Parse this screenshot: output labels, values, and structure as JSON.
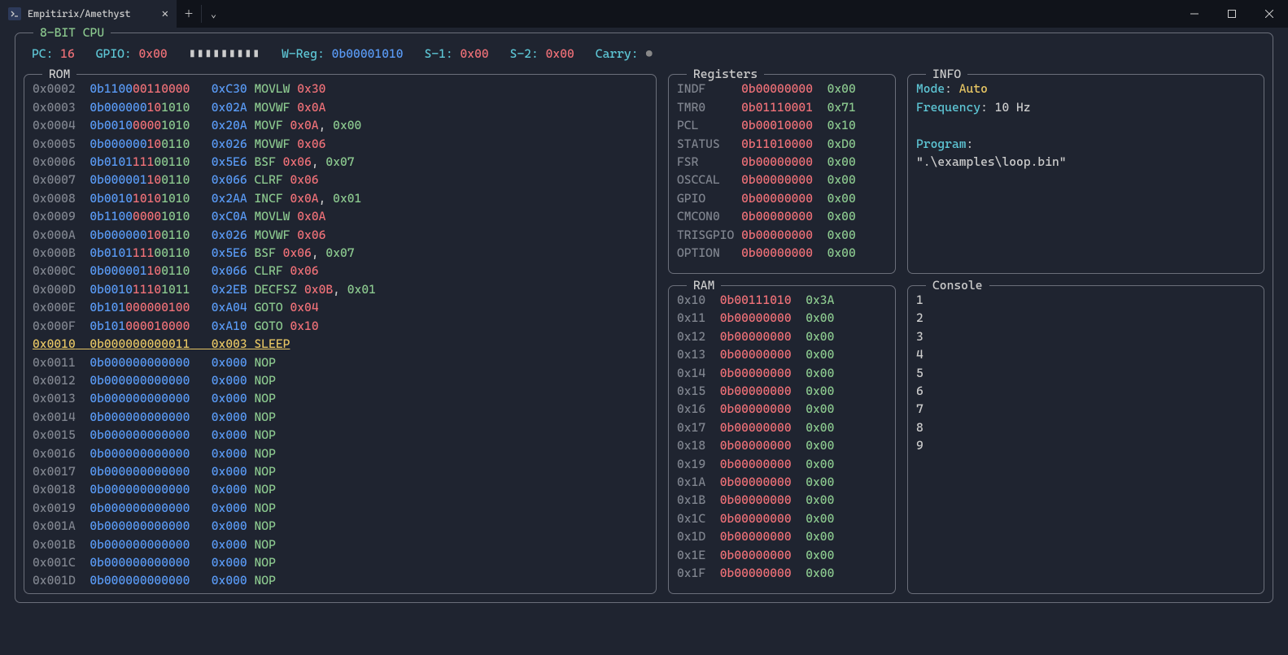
{
  "window": {
    "tab_title": "Empitirix/Amethyst"
  },
  "cpu_title": "8-BIT CPU",
  "status": {
    "pc_label": "PC:",
    "pc_value": "16",
    "gpio_label": "GPIO:",
    "gpio_value": "0x00",
    "gpio_bars": "▮▮▮▮▮▮▮▮▮",
    "wreg_label": "W-Reg:",
    "wreg_value": "0b00001010",
    "s1_label": "S-1:",
    "s1_value": "0x00",
    "s2_label": "S-2:",
    "s2_value": "0x00",
    "carry_label": "Carry:",
    "carry_dot": "●"
  },
  "rom_title": "ROM",
  "registers_title": "Registers",
  "info_title": "INFO",
  "ram_title": "RAM",
  "console_title": "Console",
  "rom": [
    {
      "addr": "0x0002",
      "bin_segs": [
        [
          "b",
          "0b1100"
        ],
        [
          "r",
          "00110000"
        ]
      ],
      "hex": "0xC30",
      "mn": "MOVLW",
      "args": [
        [
          "r",
          "0x30"
        ]
      ]
    },
    {
      "addr": "0x0003",
      "bin_segs": [
        [
          "b",
          "0b000000"
        ],
        [
          "r",
          "10"
        ],
        [
          "g",
          "1010"
        ]
      ],
      "hex": "0x02A",
      "mn": "MOVWF",
      "args": [
        [
          "r",
          "0x0A"
        ]
      ]
    },
    {
      "addr": "0x0004",
      "bin_segs": [
        [
          "b",
          "0b0010"
        ],
        [
          "r",
          "0000"
        ],
        [
          "g",
          "1010"
        ]
      ],
      "hex": "0x20A",
      "mn": "MOVF",
      "args": [
        [
          "r",
          "0x0A"
        ],
        [
          "w",
          ", "
        ],
        [
          "g",
          "0x00"
        ]
      ]
    },
    {
      "addr": "0x0005",
      "bin_segs": [
        [
          "b",
          "0b000000"
        ],
        [
          "r",
          "10"
        ],
        [
          "g",
          "0110"
        ]
      ],
      "hex": "0x026",
      "mn": "MOVWF",
      "args": [
        [
          "r",
          "0x06"
        ]
      ]
    },
    {
      "addr": "0x0006",
      "bin_segs": [
        [
          "b",
          "0b0101"
        ],
        [
          "r",
          "111"
        ],
        [
          "g",
          "00110"
        ]
      ],
      "hex": "0x5E6",
      "mn": "BSF",
      "args": [
        [
          "r",
          "0x06"
        ],
        [
          "w",
          ", "
        ],
        [
          "g",
          "0x07"
        ]
      ]
    },
    {
      "addr": "0x0007",
      "bin_segs": [
        [
          "b",
          "0b000001"
        ],
        [
          "r",
          "10"
        ],
        [
          "g",
          "0110"
        ]
      ],
      "hex": "0x066",
      "mn": "CLRF",
      "args": [
        [
          "r",
          "0x06"
        ]
      ]
    },
    {
      "addr": "0x0008",
      "bin_segs": [
        [
          "b",
          "0b0010"
        ],
        [
          "r",
          "1010"
        ],
        [
          "g",
          "1010"
        ]
      ],
      "hex": "0x2AA",
      "mn": "INCF",
      "args": [
        [
          "r",
          "0x0A"
        ],
        [
          "w",
          ", "
        ],
        [
          "g",
          "0x01"
        ]
      ]
    },
    {
      "addr": "0x0009",
      "bin_segs": [
        [
          "b",
          "0b1100"
        ],
        [
          "r",
          "0000"
        ],
        [
          "g",
          "1010"
        ]
      ],
      "hex": "0xC0A",
      "mn": "MOVLW",
      "args": [
        [
          "r",
          "0x0A"
        ]
      ]
    },
    {
      "addr": "0x000A",
      "bin_segs": [
        [
          "b",
          "0b000000"
        ],
        [
          "r",
          "10"
        ],
        [
          "g",
          "0110"
        ]
      ],
      "hex": "0x026",
      "mn": "MOVWF",
      "args": [
        [
          "r",
          "0x06"
        ]
      ]
    },
    {
      "addr": "0x000B",
      "bin_segs": [
        [
          "b",
          "0b0101"
        ],
        [
          "r",
          "111"
        ],
        [
          "g",
          "00110"
        ]
      ],
      "hex": "0x5E6",
      "mn": "BSF",
      "args": [
        [
          "r",
          "0x06"
        ],
        [
          "w",
          ", "
        ],
        [
          "g",
          "0x07"
        ]
      ]
    },
    {
      "addr": "0x000C",
      "bin_segs": [
        [
          "b",
          "0b000001"
        ],
        [
          "r",
          "10"
        ],
        [
          "g",
          "0110"
        ]
      ],
      "hex": "0x066",
      "mn": "CLRF",
      "args": [
        [
          "r",
          "0x06"
        ]
      ]
    },
    {
      "addr": "0x000D",
      "bin_segs": [
        [
          "b",
          "0b0010"
        ],
        [
          "r",
          "1110"
        ],
        [
          "g",
          "1011"
        ]
      ],
      "hex": "0x2EB",
      "mn": "DECFSZ",
      "args": [
        [
          "r",
          "0x0B"
        ],
        [
          "w",
          ", "
        ],
        [
          "g",
          "0x01"
        ]
      ]
    },
    {
      "addr": "0x000E",
      "bin_segs": [
        [
          "b",
          "0b101"
        ],
        [
          "r",
          "000000100"
        ]
      ],
      "hex": "0xA04",
      "mn": "GOTO",
      "args": [
        [
          "r",
          "0x04"
        ]
      ]
    },
    {
      "addr": "0x000F",
      "bin_segs": [
        [
          "b",
          "0b101"
        ],
        [
          "r",
          "000010000"
        ]
      ],
      "hex": "0xA10",
      "mn": "GOTO",
      "args": [
        [
          "r",
          "0x10"
        ]
      ]
    },
    {
      "addr": "0x0010",
      "bin_segs": [
        [
          "b",
          "0b000000000011"
        ]
      ],
      "hex": "0x003",
      "mn": "SLEEP",
      "args": [],
      "selected": true
    },
    {
      "addr": "0x0011",
      "bin_segs": [
        [
          "b",
          "0b000000000000"
        ]
      ],
      "hex": "0x000",
      "mn": "NOP",
      "args": []
    },
    {
      "addr": "0x0012",
      "bin_segs": [
        [
          "b",
          "0b000000000000"
        ]
      ],
      "hex": "0x000",
      "mn": "NOP",
      "args": []
    },
    {
      "addr": "0x0013",
      "bin_segs": [
        [
          "b",
          "0b000000000000"
        ]
      ],
      "hex": "0x000",
      "mn": "NOP",
      "args": []
    },
    {
      "addr": "0x0014",
      "bin_segs": [
        [
          "b",
          "0b000000000000"
        ]
      ],
      "hex": "0x000",
      "mn": "NOP",
      "args": []
    },
    {
      "addr": "0x0015",
      "bin_segs": [
        [
          "b",
          "0b000000000000"
        ]
      ],
      "hex": "0x000",
      "mn": "NOP",
      "args": []
    },
    {
      "addr": "0x0016",
      "bin_segs": [
        [
          "b",
          "0b000000000000"
        ]
      ],
      "hex": "0x000",
      "mn": "NOP",
      "args": []
    },
    {
      "addr": "0x0017",
      "bin_segs": [
        [
          "b",
          "0b000000000000"
        ]
      ],
      "hex": "0x000",
      "mn": "NOP",
      "args": []
    },
    {
      "addr": "0x0018",
      "bin_segs": [
        [
          "b",
          "0b000000000000"
        ]
      ],
      "hex": "0x000",
      "mn": "NOP",
      "args": []
    },
    {
      "addr": "0x0019",
      "bin_segs": [
        [
          "b",
          "0b000000000000"
        ]
      ],
      "hex": "0x000",
      "mn": "NOP",
      "args": []
    },
    {
      "addr": "0x001A",
      "bin_segs": [
        [
          "b",
          "0b000000000000"
        ]
      ],
      "hex": "0x000",
      "mn": "NOP",
      "args": []
    },
    {
      "addr": "0x001B",
      "bin_segs": [
        [
          "b",
          "0b000000000000"
        ]
      ],
      "hex": "0x000",
      "mn": "NOP",
      "args": []
    },
    {
      "addr": "0x001C",
      "bin_segs": [
        [
          "b",
          "0b000000000000"
        ]
      ],
      "hex": "0x000",
      "mn": "NOP",
      "args": []
    },
    {
      "addr": "0x001D",
      "bin_segs": [
        [
          "b",
          "0b000000000000"
        ]
      ],
      "hex": "0x000",
      "mn": "NOP",
      "args": []
    }
  ],
  "registers": [
    {
      "name": "INDF",
      "bin": "0b00000000",
      "hex": "0x00"
    },
    {
      "name": "TMR0",
      "bin": "0b01110001",
      "hex": "0x71"
    },
    {
      "name": "PCL",
      "bin": "0b00010000",
      "hex": "0x10"
    },
    {
      "name": "STATUS",
      "bin": "0b11010000",
      "hex": "0xD0"
    },
    {
      "name": "FSR",
      "bin": "0b00000000",
      "hex": "0x00"
    },
    {
      "name": "OSCCAL",
      "bin": "0b00000000",
      "hex": "0x00"
    },
    {
      "name": "GPIO",
      "bin": "0b00000000",
      "hex": "0x00"
    },
    {
      "name": "CMCON0",
      "bin": "0b00000000",
      "hex": "0x00"
    },
    {
      "name": "TRISGPIO",
      "bin": "0b00000000",
      "hex": "0x00"
    },
    {
      "name": "OPTION",
      "bin": "0b00000000",
      "hex": "0x00"
    }
  ],
  "info": {
    "mode_label": "Mode",
    "mode_value": "Auto",
    "freq_label": "Frequency",
    "freq_value": "10 Hz",
    "prog_label": "Program",
    "prog_value": "\".\\examples\\loop.bin\""
  },
  "ram": [
    {
      "addr": "0x10",
      "bin": "0b00111010",
      "hex": "0x3A"
    },
    {
      "addr": "0x11",
      "bin": "0b00000000",
      "hex": "0x00"
    },
    {
      "addr": "0x12",
      "bin": "0b00000000",
      "hex": "0x00"
    },
    {
      "addr": "0x13",
      "bin": "0b00000000",
      "hex": "0x00"
    },
    {
      "addr": "0x14",
      "bin": "0b00000000",
      "hex": "0x00"
    },
    {
      "addr": "0x15",
      "bin": "0b00000000",
      "hex": "0x00"
    },
    {
      "addr": "0x16",
      "bin": "0b00000000",
      "hex": "0x00"
    },
    {
      "addr": "0x17",
      "bin": "0b00000000",
      "hex": "0x00"
    },
    {
      "addr": "0x18",
      "bin": "0b00000000",
      "hex": "0x00"
    },
    {
      "addr": "0x19",
      "bin": "0b00000000",
      "hex": "0x00"
    },
    {
      "addr": "0x1A",
      "bin": "0b00000000",
      "hex": "0x00"
    },
    {
      "addr": "0x1B",
      "bin": "0b00000000",
      "hex": "0x00"
    },
    {
      "addr": "0x1C",
      "bin": "0b00000000",
      "hex": "0x00"
    },
    {
      "addr": "0x1D",
      "bin": "0b00000000",
      "hex": "0x00"
    },
    {
      "addr": "0x1E",
      "bin": "0b00000000",
      "hex": "0x00"
    },
    {
      "addr": "0x1F",
      "bin": "0b00000000",
      "hex": "0x00"
    }
  ],
  "console": [
    "1",
    "2",
    "3",
    "4",
    "5",
    "6",
    "7",
    "8",
    "9"
  ]
}
